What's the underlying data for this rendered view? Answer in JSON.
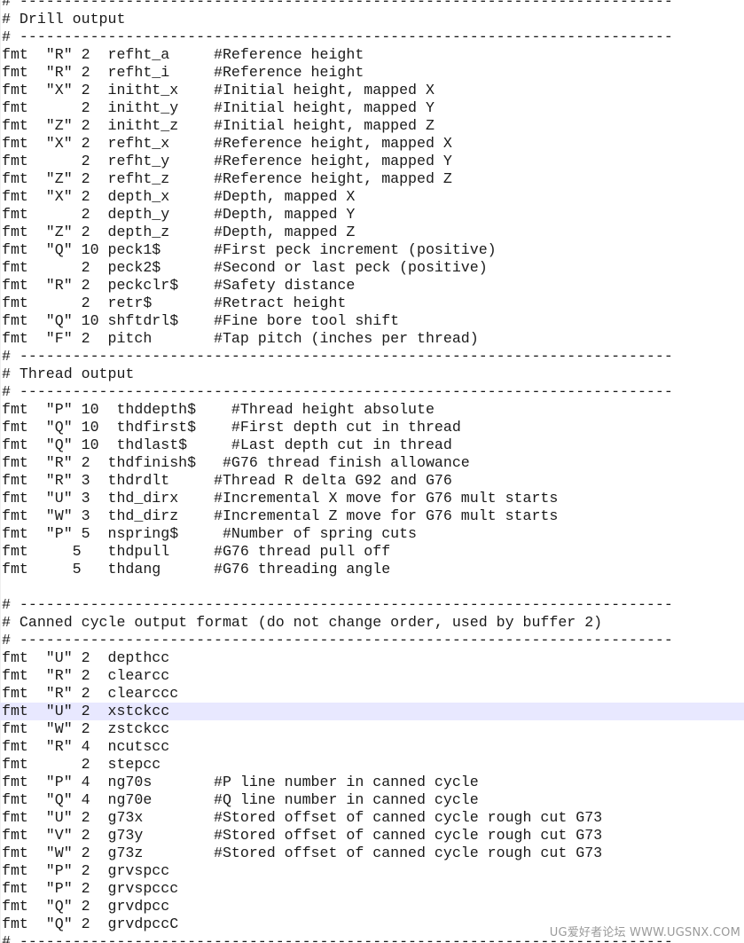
{
  "editor": {
    "lines": [
      "# --------------------------------------------------------------------------",
      "# Drill output",
      "# --------------------------------------------------------------------------",
      "fmt  \"R\" 2  refht_a     #Reference height",
      "fmt  \"R\" 2  refht_i     #Reference height",
      "fmt  \"X\" 2  initht_x    #Initial height, mapped X",
      "fmt      2  initht_y    #Initial height, mapped Y",
      "fmt  \"Z\" 2  initht_z    #Initial height, mapped Z",
      "fmt  \"X\" 2  refht_x     #Reference height, mapped X",
      "fmt      2  refht_y     #Reference height, mapped Y",
      "fmt  \"Z\" 2  refht_z     #Reference height, mapped Z",
      "fmt  \"X\" 2  depth_x     #Depth, mapped X",
      "fmt      2  depth_y     #Depth, mapped Y",
      "fmt  \"Z\" 2  depth_z     #Depth, mapped Z",
      "fmt  \"Q\" 10 peck1$      #First peck increment (positive)",
      "fmt      2  peck2$      #Second or last peck (positive)",
      "fmt  \"R\" 2  peckclr$    #Safety distance",
      "fmt      2  retr$       #Retract height",
      "fmt  \"Q\" 10 shftdrl$    #Fine bore tool shift",
      "fmt  \"F\" 2  pitch       #Tap pitch (inches per thread)",
      "# --------------------------------------------------------------------------",
      "# Thread output",
      "# --------------------------------------------------------------------------",
      "fmt  \"P\" 10  thddepth$    #Thread height absolute",
      "fmt  \"Q\" 10  thdfirst$    #First depth cut in thread",
      "fmt  \"Q\" 10  thdlast$     #Last depth cut in thread",
      "fmt  \"R\" 2  thdfinish$   #G76 thread finish allowance",
      "fmt  \"R\" 3  thdrdlt     #Thread R delta G92 and G76",
      "fmt  \"U\" 3  thd_dirx    #Incremental X move for G76 mult starts",
      "fmt  \"W\" 3  thd_dirz    #Incremental Z move for G76 mult starts",
      "fmt  \"P\" 5  nspring$     #Number of spring cuts",
      "fmt     5   thdpull     #G76 thread pull off",
      "fmt     5   thdang      #G76 threading angle",
      "",
      "# --------------------------------------------------------------------------",
      "# Canned cycle output format (do not change order, used by buffer 2)",
      "# --------------------------------------------------------------------------",
      "fmt  \"U\" 2  depthcc",
      "fmt  \"R\" 2  clearcc",
      "fmt  \"R\" 2  clearccc",
      "fmt  \"U\" 2  xstckcc",
      "fmt  \"W\" 2  zstckcc",
      "fmt  \"R\" 4  ncutscc",
      "fmt      2  stepcc",
      "fmt  \"P\" 4  ng70s       #P line number in canned cycle",
      "fmt  \"Q\" 4  ng70e       #Q line number in canned cycle",
      "fmt  \"U\" 2  g73x        #Stored offset of canned cycle rough cut G73",
      "fmt  \"V\" 2  g73y        #Stored offset of canned cycle rough cut G73",
      "fmt  \"W\" 2  g73z        #Stored offset of canned cycle rough cut G73",
      "fmt  \"P\" 2  grvspcc",
      "fmt  \"P\" 2  grvspccc",
      "fmt  \"Q\" 2  grvdpcc",
      "fmt  \"Q\" 2  grvdpccC",
      "# --------------------------------------------------------------------------"
    ],
    "current_line": 40,
    "highlight_color": "#e8e8ff"
  },
  "watermark": {
    "text": "UG爱好者论坛 WWW.UGSNX.COM"
  }
}
